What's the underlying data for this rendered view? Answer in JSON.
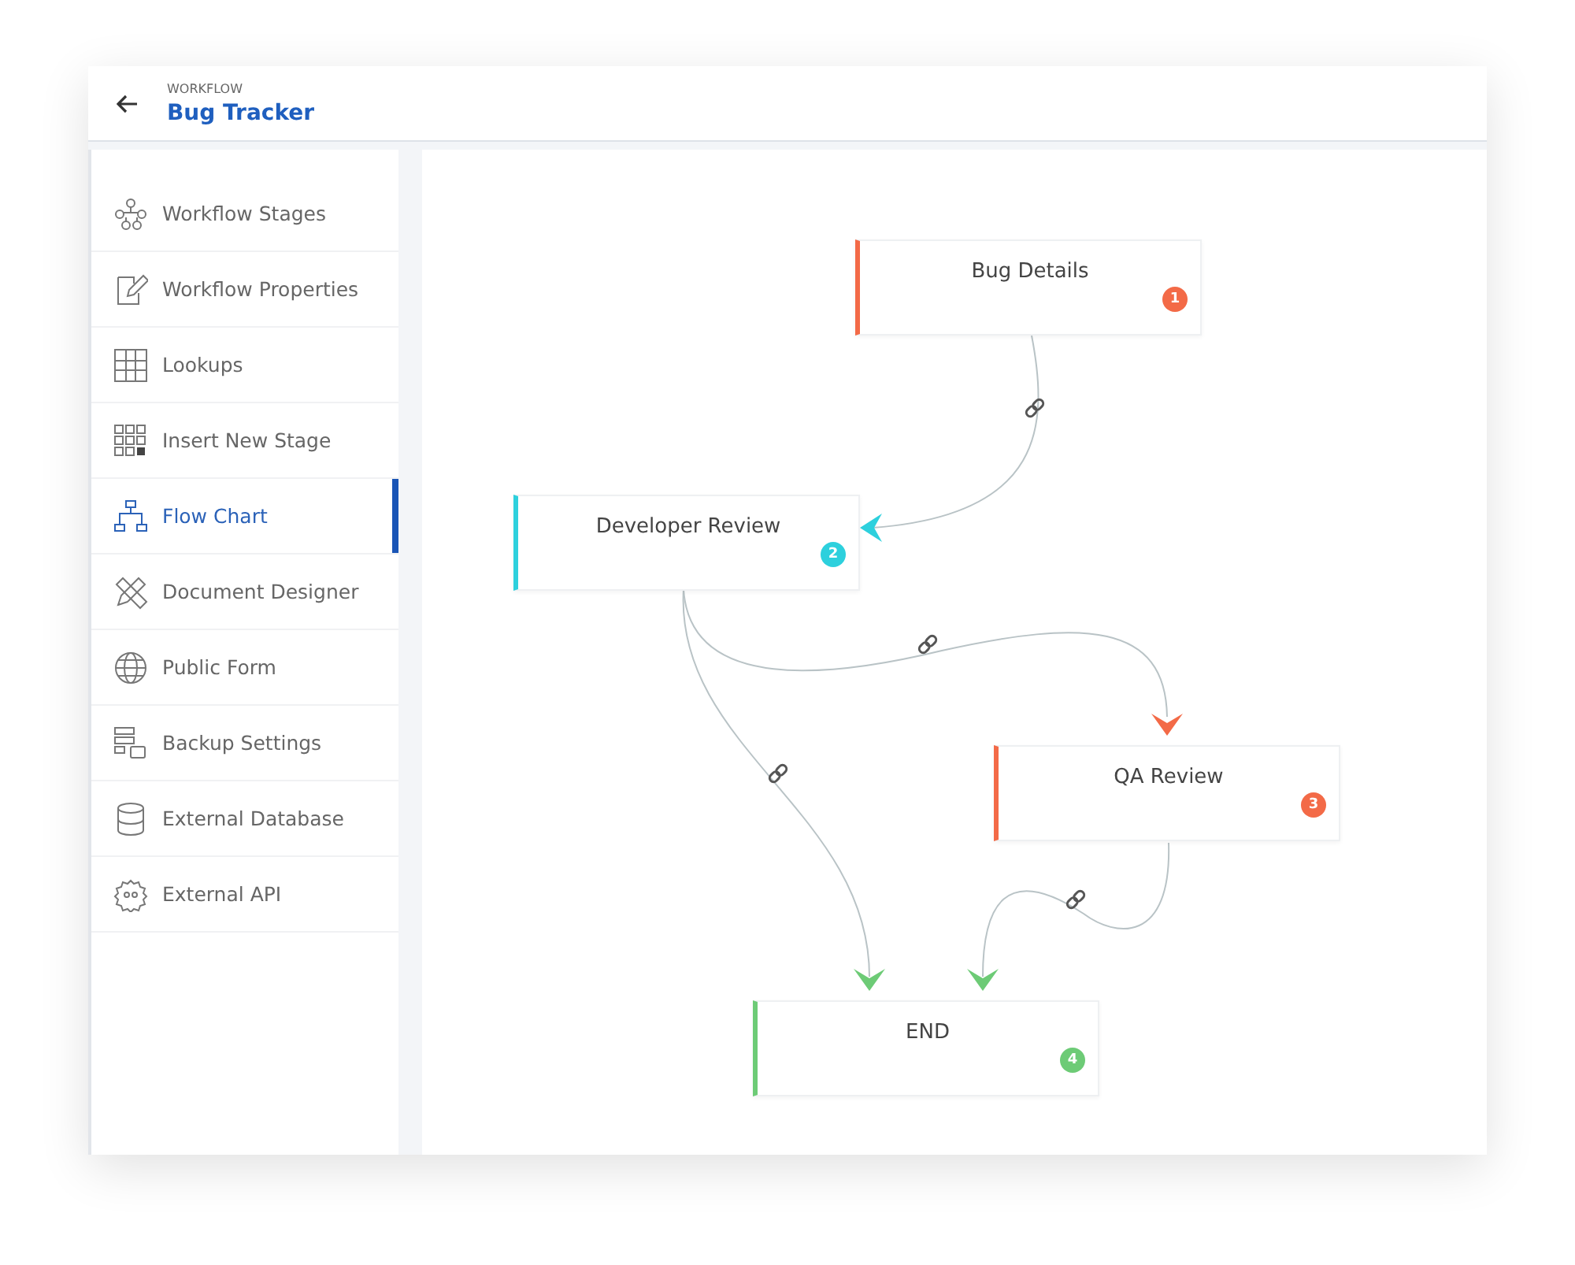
{
  "header": {
    "overline": "WORKFLOW",
    "title": "Bug Tracker"
  },
  "sidebar": {
    "items": [
      {
        "label": "Workflow Stages",
        "selected": false
      },
      {
        "label": "Workflow Properties",
        "selected": false
      },
      {
        "label": "Lookups",
        "selected": false
      },
      {
        "label": "Insert New Stage",
        "selected": false
      },
      {
        "label": "Flow Chart",
        "selected": true
      },
      {
        "label": "Document Designer",
        "selected": false
      },
      {
        "label": "Public Form",
        "selected": false
      },
      {
        "label": "Backup Settings",
        "selected": false
      },
      {
        "label": "External Database",
        "selected": false
      },
      {
        "label": "External API",
        "selected": false
      }
    ]
  },
  "flowchart": {
    "nodes": [
      {
        "title": "Bug Details",
        "number": "1",
        "color": "#f36a47"
      },
      {
        "title": "Developer Review",
        "number": "2",
        "color": "#2dd0dd"
      },
      {
        "title": "QA Review",
        "number": "3",
        "color": "#f36a47"
      },
      {
        "title": "END",
        "number": "4",
        "color": "#6dcb76"
      }
    ]
  }
}
